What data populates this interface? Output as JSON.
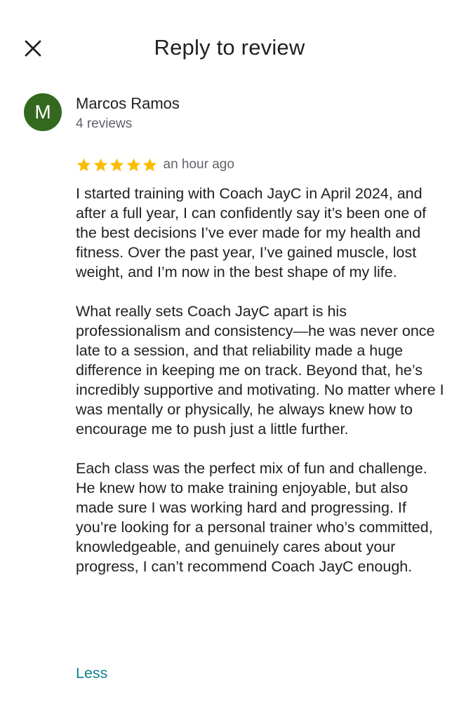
{
  "header": {
    "title": "Reply to review",
    "close_icon": "close-icon"
  },
  "reviewer": {
    "initial": "M",
    "avatar_color": "#33691e",
    "name": "Marcos Ramos",
    "reviews_count": "4 reviews"
  },
  "review": {
    "rating": 5,
    "max_rating": 5,
    "star_color": "#fbbc04",
    "time": "an hour ago",
    "paragraphs": [
      "I started training with Coach JayC in April 2024, and after a full year, I can confidently say it’s been one of the best decisions I’ve ever made for my health and fitness. Over the past year, I’ve gained muscle, lost weight, and I’m now in the best shape of my life.",
      "What really sets Coach JayC apart is his professionalism and consistency—he was never once late to a session, and that reliability made a huge difference in keeping me on track. Beyond that, he’s incredibly supportive and motivating. No matter where I was mentally or physically, he always knew how to encourage me to push just a little further.",
      "Each class was the perfect mix of fun and challenge. He knew how to make training enjoyable, but also made sure I was working hard and progressing. If you’re looking for a personal trainer who’s committed, knowledgeable, and genuinely cares about your progress, I can’t recommend Coach JayC enough."
    ],
    "less_label": "Less"
  }
}
